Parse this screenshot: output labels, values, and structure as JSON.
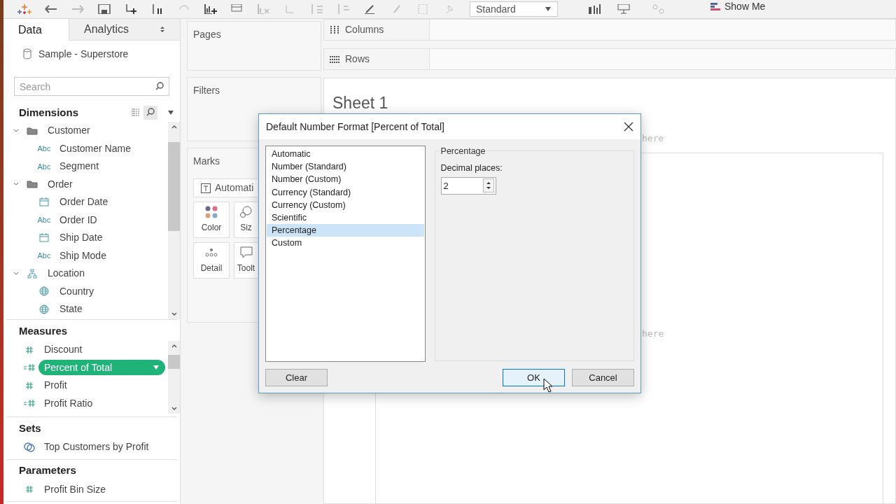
{
  "toolbar": {
    "view_size": "Standard",
    "show_me": "Show Me"
  },
  "data_pane": {
    "tabs": [
      {
        "label": "Data",
        "selected": true
      },
      {
        "label": "Analytics",
        "selected": false
      }
    ],
    "data_source": "Sample - Superstore",
    "search": {
      "placeholder": "Search"
    },
    "dimensions": {
      "title": "Dimensions",
      "items": [
        {
          "label": "Customer",
          "kind": "folder",
          "expanded": true,
          "children": [
            {
              "label": "Customer Name",
              "kind": "string",
              "type_label": "Abc"
            },
            {
              "label": "Segment",
              "kind": "string",
              "type_label": "Abc"
            }
          ]
        },
        {
          "label": "Order",
          "kind": "folder",
          "expanded": true,
          "children": [
            {
              "label": "Order Date",
              "kind": "date"
            },
            {
              "label": "Order ID",
              "kind": "string",
              "type_label": "Abc"
            },
            {
              "label": "Ship Date",
              "kind": "date"
            },
            {
              "label": "Ship Mode",
              "kind": "string",
              "type_label": "Abc"
            }
          ]
        },
        {
          "label": "Location",
          "kind": "hierarchy",
          "expanded": true,
          "children": [
            {
              "label": "Country",
              "kind": "geo"
            },
            {
              "label": "State",
              "kind": "geo"
            }
          ]
        }
      ]
    },
    "measures": {
      "title": "Measures",
      "items": [
        {
          "label": "Discount",
          "kind": "number",
          "selected": false
        },
        {
          "label": "Percent of Total",
          "kind": "calculated",
          "selected": true
        },
        {
          "label": "Profit",
          "kind": "number",
          "selected": false
        },
        {
          "label": "Profit Ratio",
          "kind": "calculated",
          "selected": false
        }
      ]
    },
    "sets": {
      "title": "Sets",
      "items": [
        {
          "label": "Top Customers by Profit"
        }
      ]
    },
    "parameters": {
      "title": "Parameters",
      "items": [
        {
          "label": "Profit Bin Size"
        }
      ]
    }
  },
  "pages": {
    "title": "Pages"
  },
  "filters": {
    "title": "Filters"
  },
  "marks": {
    "title": "Marks",
    "mark_type": "Automati",
    "cards": [
      {
        "label": "Color",
        "kind": "color"
      },
      {
        "label": "Siz",
        "kind": "size"
      },
      {
        "label": "Detail",
        "kind": "detail"
      },
      {
        "label": "Toolt",
        "kind": "tooltip"
      }
    ]
  },
  "shelves": [
    {
      "label": "Columns",
      "kind": "columns"
    },
    {
      "label": "Rows",
      "kind": "rows"
    }
  ],
  "sheet": {
    "title": "Sheet 1",
    "drop_hints": [
      "here",
      "here"
    ]
  },
  "dialog": {
    "title": "Default Number Format [Percent of Total]",
    "formats": [
      {
        "label": "Automatic",
        "selected": false
      },
      {
        "label": "Number (Standard)",
        "selected": false
      },
      {
        "label": "Number (Custom)",
        "selected": false
      },
      {
        "label": "Currency (Standard)",
        "selected": false
      },
      {
        "label": "Currency (Custom)",
        "selected": false
      },
      {
        "label": "Scientific",
        "selected": false
      },
      {
        "label": "Percentage",
        "selected": true
      },
      {
        "label": "Custom",
        "selected": false
      }
    ],
    "group": "Percentage",
    "decimal_label": "Decimal places:",
    "decimal_value": "2",
    "buttons": [
      {
        "label": "Clear",
        "kind": "clear",
        "focused": false
      },
      {
        "label": "OK",
        "kind": "ok",
        "focused": true
      },
      {
        "label": "Cancel",
        "kind": "cancel",
        "focused": false
      }
    ]
  }
}
